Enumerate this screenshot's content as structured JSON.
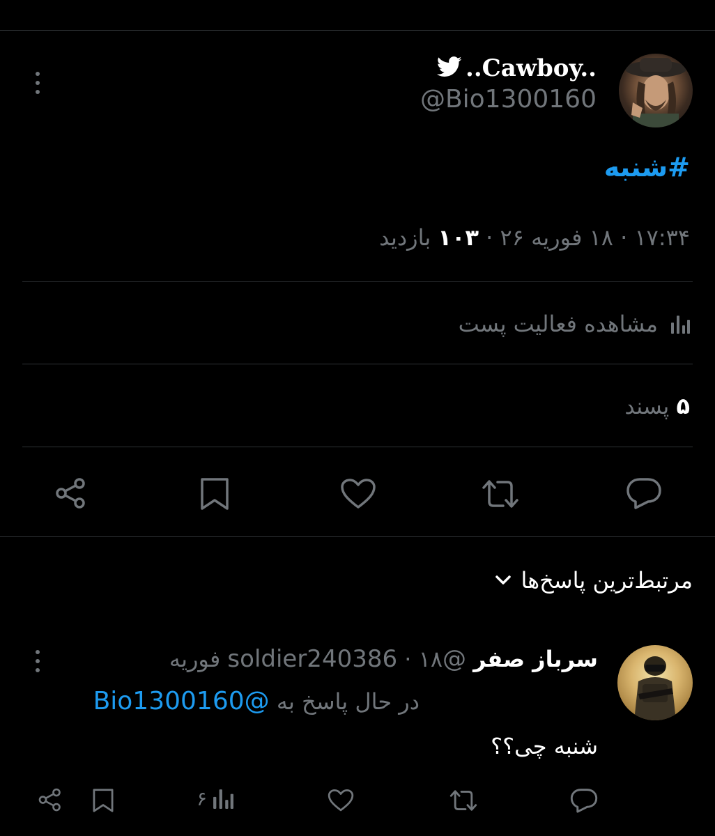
{
  "tweet": {
    "display_name": "..Cawboy..",
    "handle": "@Bio1300160",
    "hashtag": "#شنبه",
    "meta_time": "۱۷:۳۴",
    "meta_date": "۱۸ فوریه ۲۶",
    "meta_sep": "·",
    "views_count": "۱۰۳",
    "views_label": "بازدید",
    "activity_label": "مشاهده فعالیت پست",
    "likes_count": "۵",
    "likes_label": "پسند"
  },
  "replies_header": {
    "label": "مرتبط‌ترین پاسخ‌ها"
  },
  "reply": {
    "display_name": "سرباز صفر",
    "handle": "@soldier240386",
    "sep": "·",
    "date": "۱۸ فوریه",
    "replying_to_label": "در حال پاسخ به",
    "replying_to_handle": "@Bio1300160",
    "text": "شنبه چی؟؟",
    "views_count": "۶"
  },
  "colors": {
    "background": "#000000",
    "text": "#e7e9ea",
    "muted": "#71767b",
    "accent": "#1d9bf0",
    "divider": "#2f3336"
  },
  "icons": [
    "more-icon",
    "twitter-bird-icon",
    "chart-icon",
    "reply-icon",
    "retweet-icon",
    "like-icon",
    "bookmark-icon",
    "share-icon",
    "chevron-down-icon"
  ]
}
